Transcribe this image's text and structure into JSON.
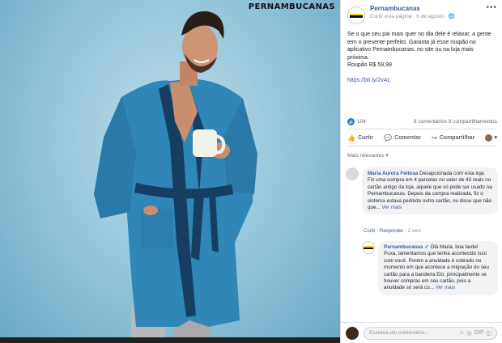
{
  "photo": {
    "brand_watermark": "PERNAMBUCANAS"
  },
  "post": {
    "page_name": "Pernambucanas",
    "meta": "Curtir esta página · 6 de agosto · ",
    "text": "Se o que seu pai mais quer no dia dele é relaxar, a gente tem o presente perfeito. Garanta já esse roupão no aplicativo Pernambucanas, no site ou na loja mais próxima.",
    "price": "Roupão R$ 59,99",
    "link": "https://bit.ly/2vAL",
    "reactions_count": "104",
    "comments_shares": "8 comentários 9 compartilhamentos"
  },
  "actions": {
    "like": "Curtir",
    "comment": "Comentar",
    "share": "Compartilhar"
  },
  "filter_label": "Mais relevantes ▾",
  "comments": [
    {
      "author": "Maria Aurora Feitosa",
      "text": "Desapcionada com esta loja. Fiz uma compra em 4 parcelas no valor de 43 reais no cartão antigo da loja, aquele que só pode ser usado na Pernambucanas. Depois da compra realizada, fiz o sistema estava pedindo outro cartão, ou disse que não que...",
      "see_more": "Ver mais",
      "like": "Curtir",
      "reply": "Responder",
      "time": "2 sem"
    },
    {
      "author": "Pernambucanas",
      "greeting": "Olá Maria, boa tarde!",
      "text": "Poxa, lamentamos que tenha acontecido isso com você. Porém a anuidade é cobrado no momento em que acontece a migração do seu cartão para a bandeira Elo, principalmente se houver compras em seu cartão, pois a anuidade só será co...",
      "see_more": "Ver mais"
    }
  ],
  "composer": {
    "placeholder": "Escreva um comentário...",
    "tools": [
      "☺",
      "◎",
      "GIF",
      "◫"
    ]
  }
}
